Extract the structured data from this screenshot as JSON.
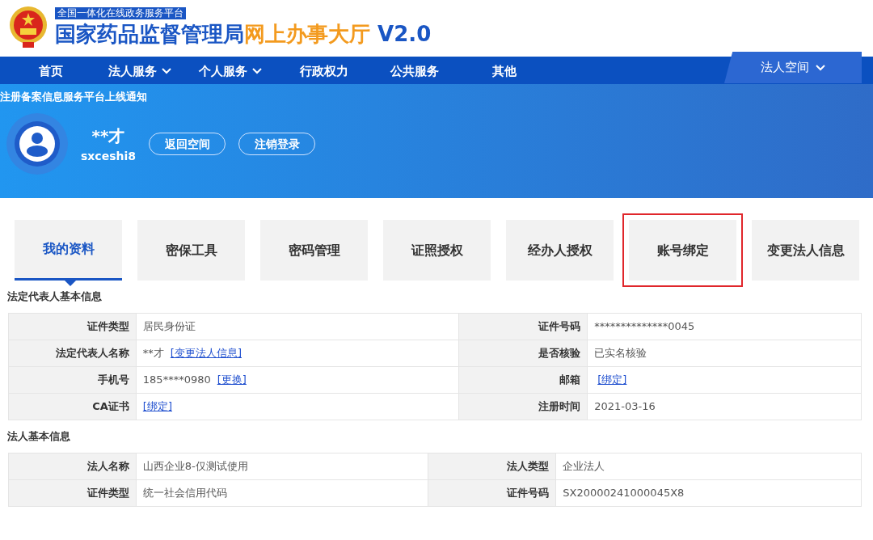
{
  "header": {
    "badge": "全国一体化在线政务服务平台",
    "title": "国家药品监督管理局",
    "title_accent": "网上办事大厅",
    "version": "V2.0"
  },
  "nav": {
    "items": [
      {
        "label": "首页",
        "dropdown": false
      },
      {
        "label": "法人服务",
        "dropdown": true
      },
      {
        "label": "个人服务",
        "dropdown": true
      },
      {
        "label": "行政权力",
        "dropdown": false
      },
      {
        "label": "公共服务",
        "dropdown": false
      },
      {
        "label": "其他",
        "dropdown": false
      }
    ],
    "space": {
      "label": "法人空间",
      "dropdown": true
    }
  },
  "notice": "注册备案信息服务平台上线通知",
  "user": {
    "name": "**才",
    "username": "sxceshi8",
    "buttons": [
      "返回空间",
      "注销登录"
    ]
  },
  "tabs": [
    {
      "label": "我的资料",
      "selected": true,
      "outlined": false
    },
    {
      "label": "密保工具",
      "selected": false,
      "outlined": false
    },
    {
      "label": "密码管理",
      "selected": false,
      "outlined": false
    },
    {
      "label": "证照授权",
      "selected": false,
      "outlined": false
    },
    {
      "label": "经办人授权",
      "selected": false,
      "outlined": false
    },
    {
      "label": "账号绑定",
      "selected": false,
      "outlined": true
    },
    {
      "label": "变更法人信息",
      "selected": false,
      "outlined": false
    }
  ],
  "sections": [
    {
      "title": "法定代表人基本信息",
      "rows": [
        [
          {
            "label": "证件类型",
            "value": "居民身份证"
          },
          {
            "label": "证件号码",
            "value": "**************0045"
          }
        ],
        [
          {
            "label": "法定代表人名称",
            "value": "**才",
            "link": "[变更法人信息]"
          },
          {
            "label": "是否核验",
            "value": "已实名核验"
          }
        ],
        [
          {
            "label": "手机号",
            "value": "185****0980",
            "link": "[更换]"
          },
          {
            "label": "邮箱",
            "link": "[绑定]"
          }
        ],
        [
          {
            "label": "CA证书",
            "link": "[绑定]"
          },
          {
            "label": "注册时间",
            "value": "2021-03-16"
          }
        ]
      ]
    },
    {
      "title": "法人基本信息",
      "rows": [
        [
          {
            "label": "法人名称",
            "value": "山西企业8-仅测试使用"
          },
          {
            "label": "法人类型",
            "value": "企业法人"
          }
        ],
        [
          {
            "label": "证件类型",
            "value": "统一社会信用代码"
          },
          {
            "label": "证件号码",
            "value": "SX20000241000045X8"
          }
        ]
      ]
    }
  ]
}
